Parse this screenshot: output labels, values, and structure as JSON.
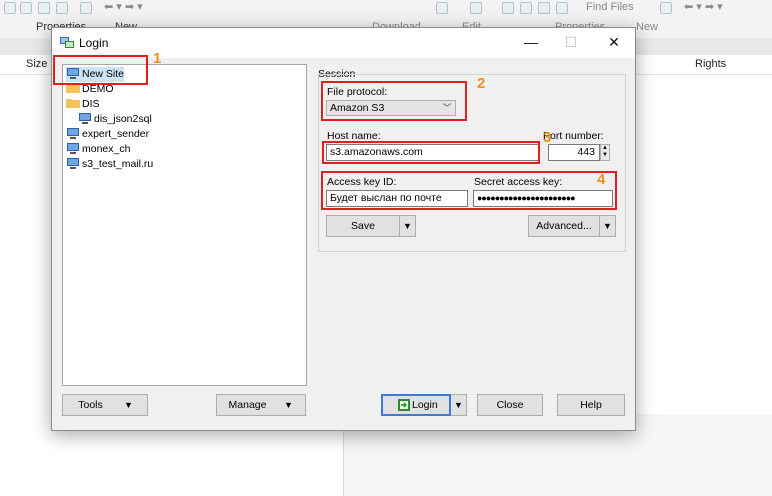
{
  "background": {
    "toolbar_left": "Properties",
    "toolbar_left2": "New",
    "toolbar_right_download": "Download",
    "toolbar_right_edit": "Edit",
    "toolbar_right_properties": "Properties",
    "toolbar_right_new": "New",
    "find_files": "Find Files",
    "col_size": "Size",
    "col_rights": "Rights"
  },
  "dialog": {
    "title": "Login",
    "minimize": "—",
    "maximize": "☐",
    "close": "✕"
  },
  "tree": {
    "items": [
      {
        "label": "New Site",
        "icon": "computer-icon"
      },
      {
        "label": "DEMO",
        "icon": "folder-icon"
      },
      {
        "label": "DIS",
        "icon": "folder-icon"
      },
      {
        "label": "dis_json2sql",
        "icon": "computer-icon"
      },
      {
        "label": "expert_sender",
        "icon": "computer-icon"
      },
      {
        "label": "monex_ch",
        "icon": "computer-icon"
      },
      {
        "label": "s3_test_mail.ru",
        "icon": "computer-icon"
      }
    ]
  },
  "session": {
    "label": "Session",
    "file_protocol_label": "File protocol:",
    "file_protocol_value": "Amazon S3",
    "host_name_label": "Host name:",
    "host_name_value": "s3.amazonaws.com",
    "port_label": "Port number:",
    "port_value": "443",
    "access_key_label": "Access key ID:",
    "access_key_value": "Будет выслан по почте",
    "secret_key_label": "Secret access key:",
    "secret_key_value": "●●●●●●●●●●●●●●●●●●●●●●"
  },
  "buttons": {
    "save": "Save",
    "advanced": "Advanced...",
    "tools": "Tools",
    "manage": "Manage",
    "login": "Login",
    "close": "Close",
    "help": "Help"
  },
  "annotations": {
    "n1": "1",
    "n2": "2",
    "n3": "3",
    "n4": "4"
  },
  "colors": {
    "highlight_red": "#e02020",
    "annotation_orange": "#f0901a",
    "login_button_border": "#3a7bd5"
  }
}
